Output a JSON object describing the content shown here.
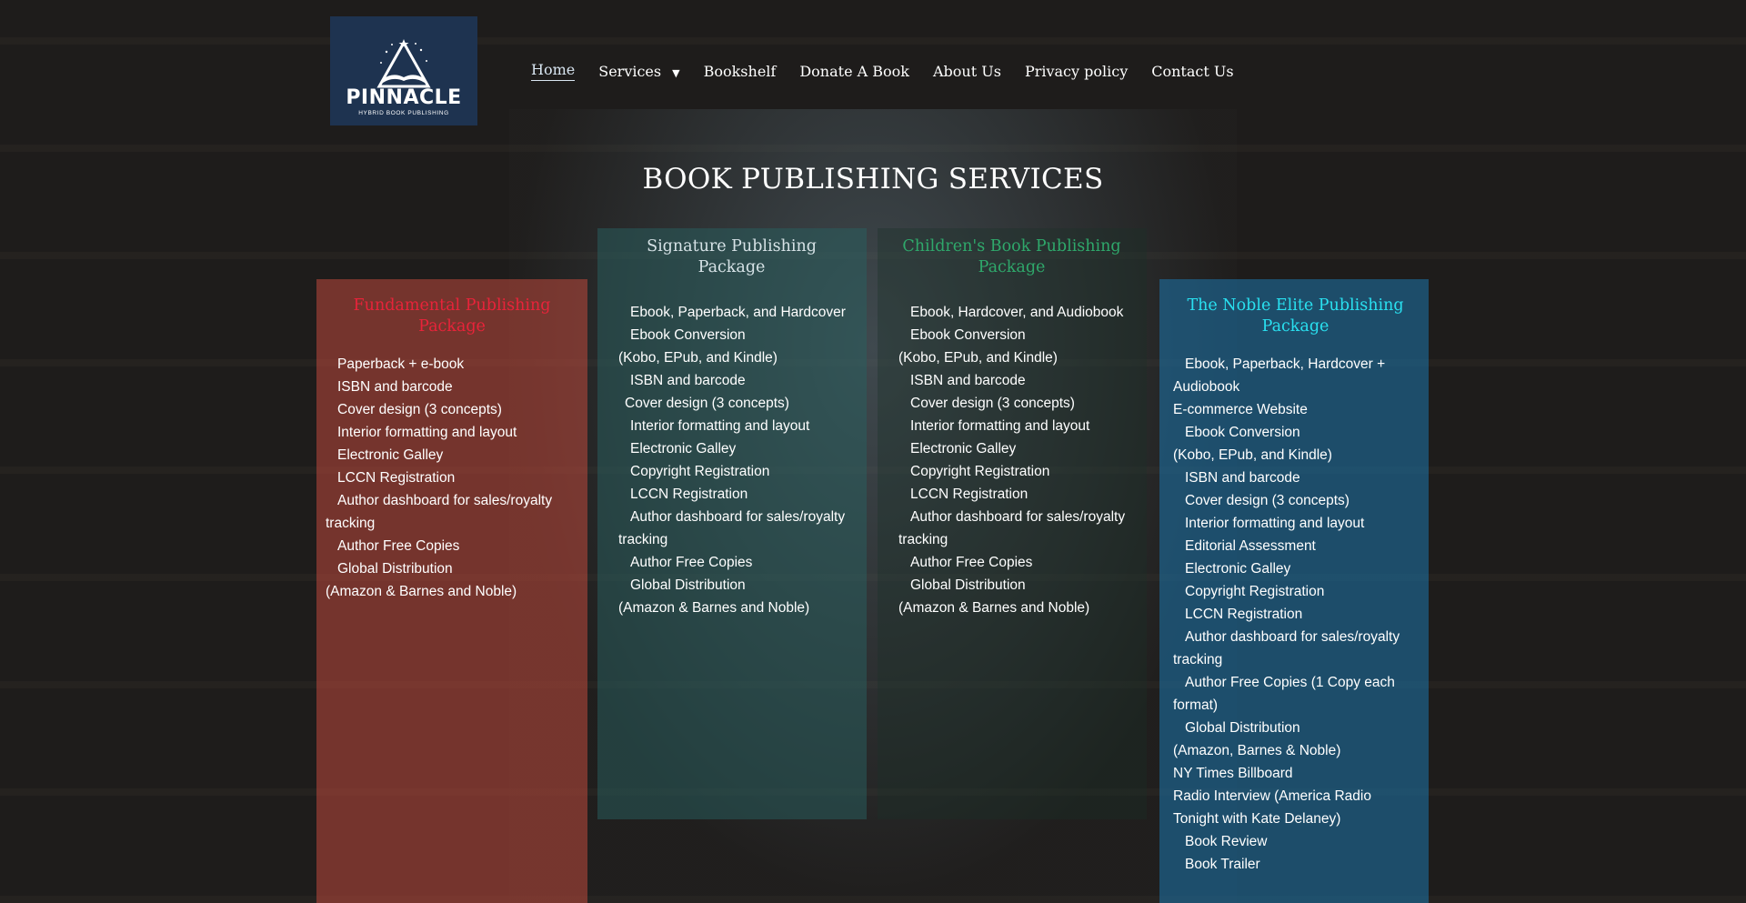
{
  "brand": {
    "name": "PINNACLE",
    "tagline": "HYBRID BOOK PUBLISHING",
    "bg_color": "#1e3350"
  },
  "nav": {
    "items": [
      {
        "label": "Home",
        "active": true
      },
      {
        "label": "Services",
        "has_dropdown": true
      },
      {
        "label": "Bookshelf"
      },
      {
        "label": "Donate A Book"
      },
      {
        "label": "About Us"
      },
      {
        "label": "Privacy policy"
      },
      {
        "label": "Contact Us"
      }
    ],
    "dropdown_icon": "caret-down-icon"
  },
  "page": {
    "title": "BOOK PUBLISHING SERVICES"
  },
  "packages": [
    {
      "title": "Fundamental Publishing Package",
      "title_color": "#e8233a",
      "items": [
        "Paperback + e-book",
        "ISBN and barcode",
        "Cover design (3 concepts)",
        "Interior formatting and layout",
        "Electronic Galley",
        "LCCN Registration",
        "Author dashboard for sales/royalty tracking",
        "Author Free Copies",
        "Global Distribution",
        "(Amazon & Barnes and Noble)"
      ]
    },
    {
      "title": "Signature Publishing Package",
      "title_color": "#d6e2e6",
      "items": [
        "Ebook, Paperback, and Hardcover",
        "Ebook Conversion",
        "(Kobo, EPub, and Kindle)",
        "ISBN and barcode",
        "Cover design (3 concepts)",
        "Interior formatting and layout",
        "Electronic Galley",
        "Copyright Registration",
        "LCCN Registration",
        "Author dashboard for sales/royalty tracking",
        "Author Free Copies",
        "Global Distribution",
        "(Amazon & Barnes and Noble)"
      ]
    },
    {
      "title": "Children's Book Publishing Package",
      "title_color": "#2fa86b",
      "items": [
        "Ebook, Hardcover, and Audiobook",
        "Ebook Conversion",
        "(Kobo, EPub, and Kindle)",
        "ISBN and barcode",
        "Cover design (3 concepts)",
        "Interior formatting and layout",
        "Electronic Galley",
        "Copyright Registration",
        "LCCN Registration",
        "Author dashboard for sales/royalty tracking",
        "Author Free Copies",
        "Global Distribution",
        "(Amazon & Barnes and Noble)"
      ]
    },
    {
      "title": "The Noble Elite Publishing Package",
      "title_color": "#29e0f0",
      "items": [
        "Ebook, Paperback, Hardcover + Audiobook",
        "E-commerce Website",
        "Ebook Conversion",
        "(Kobo, EPub, and Kindle)",
        "ISBN and barcode",
        "Cover design (3 concepts)",
        "Interior formatting and layout",
        "Editorial Assessment",
        "Electronic Galley",
        "Copyright Registration",
        "LCCN Registration",
        "Author dashboard for sales/royalty tracking",
        "Author Free Copies (1 Copy each format)",
        "Global Distribution",
        "(Amazon, Barnes & Noble)",
        "NY Times Billboard",
        "Radio Interview (America Radio Tonight with Kate Delaney)",
        "Book Review",
        "Book Trailer"
      ]
    }
  ]
}
